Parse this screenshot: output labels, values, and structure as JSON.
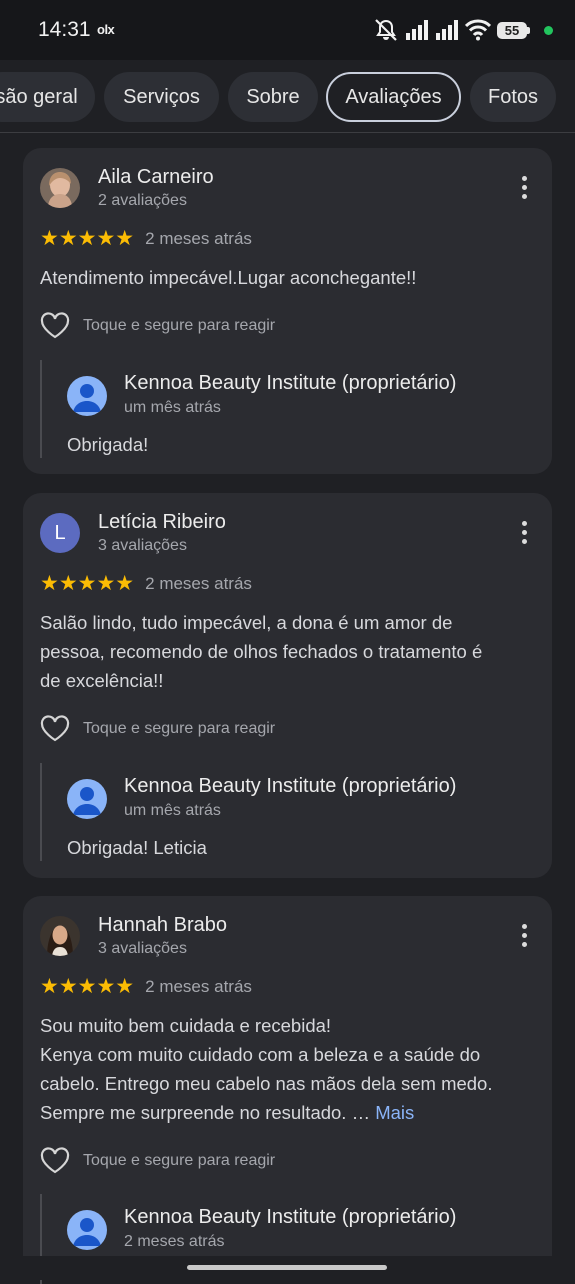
{
  "status_bar": {
    "time": "14:31",
    "app_badge": "olx",
    "battery_level": "55",
    "icons": [
      "mute-icon",
      "signal-icon",
      "signal-icon",
      "wifi-icon",
      "battery-icon",
      "active-dot"
    ]
  },
  "tabs": [
    {
      "label": "são geral",
      "active": false
    },
    {
      "label": "Serviços",
      "active": false
    },
    {
      "label": "Sobre",
      "active": false
    },
    {
      "label": "Avaliações",
      "active": true
    },
    {
      "label": "Fotos",
      "active": false
    }
  ],
  "reviews": [
    {
      "name": "Aila Carneiro",
      "reviews_count": "2 avaliações",
      "stars": "★★★★★",
      "rating": 5,
      "ago": "2 meses atrás",
      "text": "Atendimento impecável.Lugar aconchegante!!",
      "react_label": "Toque e segure para reagir",
      "reply": {
        "owner": "Kennoa Beauty Institute (proprietário)",
        "ago": "um mês atrás",
        "text": "Obrigada!"
      }
    },
    {
      "name": "Letícia Ribeiro",
      "avatar_letter": "L",
      "reviews_count": "3 avaliações",
      "stars": "★★★★★",
      "rating": 5,
      "ago": "2 meses atrás",
      "text_lines": [
        "Salão lindo, tudo impecável, a dona é um amor de",
        "pessoa, recomendo de olhos fechados o tratamento é",
        "de excelência!!"
      ],
      "react_label": "Toque e segure para reagir",
      "reply": {
        "owner": "Kennoa Beauty Institute (proprietário)",
        "ago": "um mês atrás",
        "text": "Obrigada! Leticia"
      }
    },
    {
      "name": "Hannah Brabo",
      "reviews_count": "3 avaliações",
      "stars": "★★★★★",
      "rating": 5,
      "ago": "2 meses atrás",
      "text_lines": [
        "Sou muito bem cuidada e recebida!",
        "Kenya com muito cuidado com a beleza e a saúde do",
        "cabelo. Entrego meu cabelo nas mãos dela sem medo.",
        "Sempre me surpreende no resultado. …"
      ],
      "more_label": "Mais",
      "react_label": "Toque e segure para reagir",
      "reply": {
        "owner": "Kennoa Beauty Institute (proprietário)",
        "ago": "2 meses atrás",
        "text": ""
      }
    }
  ],
  "colors": {
    "background": "#1f2024",
    "card": "#2b2c31",
    "star": "#fbbc04",
    "link": "#8ab4f8",
    "status_dot": "#22c55e"
  }
}
